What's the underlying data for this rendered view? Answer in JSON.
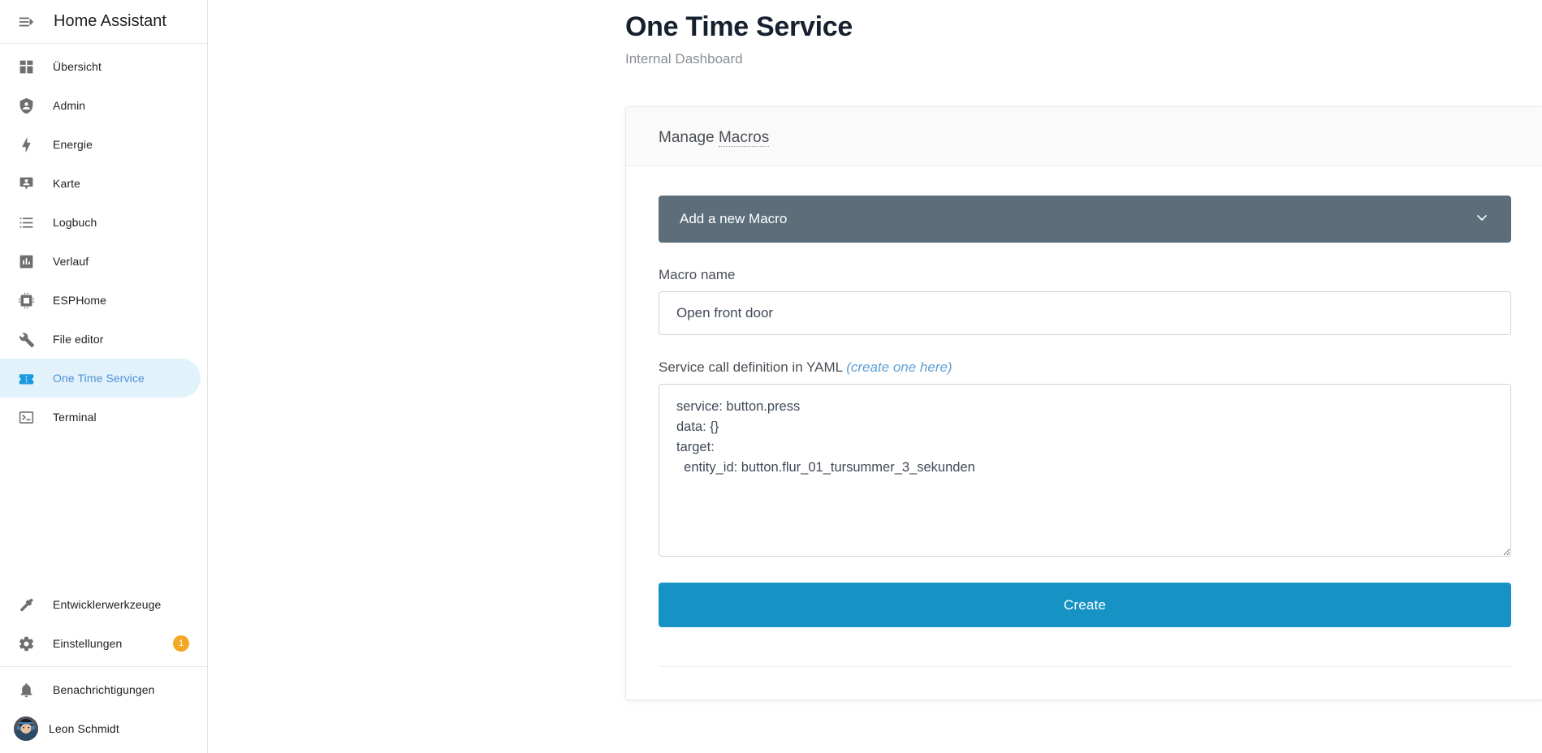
{
  "sidebar": {
    "menu_icon": "menu-open-icon",
    "title": "Home Assistant",
    "items": [
      {
        "label": "Übersicht",
        "icon": "view-dashboard-icon",
        "active": false
      },
      {
        "label": "Admin",
        "icon": "shield-account-icon",
        "active": false
      },
      {
        "label": "Energie",
        "icon": "lightning-bolt-icon",
        "active": false
      },
      {
        "label": "Karte",
        "icon": "map-marker-account-icon",
        "active": false
      },
      {
        "label": "Logbuch",
        "icon": "format-list-bulleted-icon",
        "active": false
      },
      {
        "label": "Verlauf",
        "icon": "chart-box-icon",
        "active": false
      },
      {
        "label": "ESPHome",
        "icon": "chip-icon",
        "active": false
      },
      {
        "label": "File editor",
        "icon": "wrench-icon",
        "active": false
      },
      {
        "label": "One Time Service",
        "icon": "ticket-icon",
        "active": true
      },
      {
        "label": "Terminal",
        "icon": "console-icon",
        "active": false
      }
    ],
    "tools": [
      {
        "label": "Entwicklerwerkzeuge",
        "icon": "hammer-icon",
        "badge": ""
      },
      {
        "label": "Einstellungen",
        "icon": "cog-icon",
        "badge": "1"
      }
    ],
    "bottom": [
      {
        "label": "Benachrichtigungen",
        "icon": "bell-icon"
      }
    ],
    "user": {
      "label": "Leon Schmidt",
      "icon": "avatar"
    },
    "badge_color": "#f5a623",
    "active_color": "#4e8fd8",
    "active_bg": "#e2f2fb"
  },
  "page": {
    "title": "One Time Service",
    "subtitle": "Internal Dashboard"
  },
  "card": {
    "header_prefix": "Manage ",
    "header_term": "Macros",
    "accordion": {
      "label": "Add a new Macro",
      "chevron_icon": "chevron-down-icon",
      "bg": "#5b6e7a"
    },
    "macro_name": {
      "label": "Macro name",
      "value": "Open front door",
      "placeholder": "Macro name"
    },
    "yaml": {
      "label": "Service call definition in YAML ",
      "link": "(create one here)",
      "value": "service: button.press\ndata: {}\ntarget:\n  entity_id: button.flur_01_tursummer_3_sekunden",
      "placeholder": "service: ..."
    },
    "create_label": "Create",
    "create_color": "#1693c4"
  }
}
